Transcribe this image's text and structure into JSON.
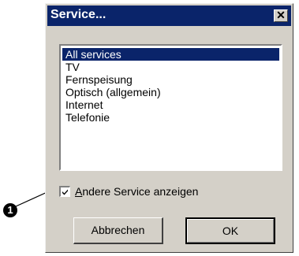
{
  "dialog": {
    "title": "Service...",
    "close_glyph": "✕"
  },
  "list": {
    "items": [
      {
        "label": "All services",
        "selected": true
      },
      {
        "label": "TV",
        "selected": false
      },
      {
        "label": "Fernspeisung",
        "selected": false
      },
      {
        "label": "Optisch (allgemein)",
        "selected": false
      },
      {
        "label": "Internet",
        "selected": false
      },
      {
        "label": "Telefonie",
        "selected": false
      }
    ]
  },
  "checkbox": {
    "checked": true,
    "accel": "A",
    "label_rest": "ndere Service anzeigen"
  },
  "buttons": {
    "cancel": "Abbrechen",
    "ok": "OK"
  },
  "callout": {
    "number": "1"
  },
  "colors": {
    "titlebar": "#0a246a",
    "dialog_bg": "#d4d0c8",
    "selection": "#0a246a"
  }
}
